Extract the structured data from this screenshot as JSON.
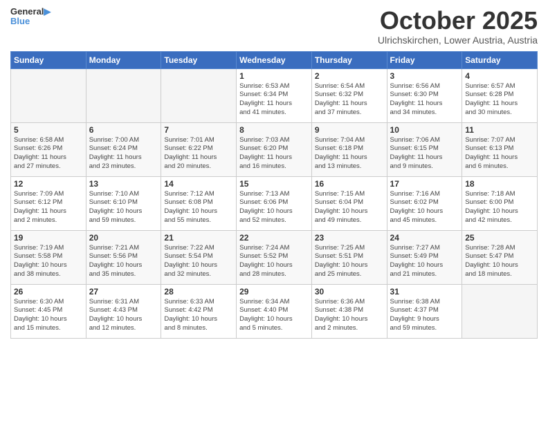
{
  "header": {
    "logo_line1": "General",
    "logo_line2": "Blue",
    "month_title": "October 2025",
    "subtitle": "Ulrichskirchen, Lower Austria, Austria"
  },
  "weekdays": [
    "Sunday",
    "Monday",
    "Tuesday",
    "Wednesday",
    "Thursday",
    "Friday",
    "Saturday"
  ],
  "weeks": [
    [
      {
        "day": "",
        "info": ""
      },
      {
        "day": "",
        "info": ""
      },
      {
        "day": "",
        "info": ""
      },
      {
        "day": "1",
        "info": "Sunrise: 6:53 AM\nSunset: 6:34 PM\nDaylight: 11 hours\nand 41 minutes."
      },
      {
        "day": "2",
        "info": "Sunrise: 6:54 AM\nSunset: 6:32 PM\nDaylight: 11 hours\nand 37 minutes."
      },
      {
        "day": "3",
        "info": "Sunrise: 6:56 AM\nSunset: 6:30 PM\nDaylight: 11 hours\nand 34 minutes."
      },
      {
        "day": "4",
        "info": "Sunrise: 6:57 AM\nSunset: 6:28 PM\nDaylight: 11 hours\nand 30 minutes."
      }
    ],
    [
      {
        "day": "5",
        "info": "Sunrise: 6:58 AM\nSunset: 6:26 PM\nDaylight: 11 hours\nand 27 minutes."
      },
      {
        "day": "6",
        "info": "Sunrise: 7:00 AM\nSunset: 6:24 PM\nDaylight: 11 hours\nand 23 minutes."
      },
      {
        "day": "7",
        "info": "Sunrise: 7:01 AM\nSunset: 6:22 PM\nDaylight: 11 hours\nand 20 minutes."
      },
      {
        "day": "8",
        "info": "Sunrise: 7:03 AM\nSunset: 6:20 PM\nDaylight: 11 hours\nand 16 minutes."
      },
      {
        "day": "9",
        "info": "Sunrise: 7:04 AM\nSunset: 6:18 PM\nDaylight: 11 hours\nand 13 minutes."
      },
      {
        "day": "10",
        "info": "Sunrise: 7:06 AM\nSunset: 6:15 PM\nDaylight: 11 hours\nand 9 minutes."
      },
      {
        "day": "11",
        "info": "Sunrise: 7:07 AM\nSunset: 6:13 PM\nDaylight: 11 hours\nand 6 minutes."
      }
    ],
    [
      {
        "day": "12",
        "info": "Sunrise: 7:09 AM\nSunset: 6:12 PM\nDaylight: 11 hours\nand 2 minutes."
      },
      {
        "day": "13",
        "info": "Sunrise: 7:10 AM\nSunset: 6:10 PM\nDaylight: 10 hours\nand 59 minutes."
      },
      {
        "day": "14",
        "info": "Sunrise: 7:12 AM\nSunset: 6:08 PM\nDaylight: 10 hours\nand 55 minutes."
      },
      {
        "day": "15",
        "info": "Sunrise: 7:13 AM\nSunset: 6:06 PM\nDaylight: 10 hours\nand 52 minutes."
      },
      {
        "day": "16",
        "info": "Sunrise: 7:15 AM\nSunset: 6:04 PM\nDaylight: 10 hours\nand 49 minutes."
      },
      {
        "day": "17",
        "info": "Sunrise: 7:16 AM\nSunset: 6:02 PM\nDaylight: 10 hours\nand 45 minutes."
      },
      {
        "day": "18",
        "info": "Sunrise: 7:18 AM\nSunset: 6:00 PM\nDaylight: 10 hours\nand 42 minutes."
      }
    ],
    [
      {
        "day": "19",
        "info": "Sunrise: 7:19 AM\nSunset: 5:58 PM\nDaylight: 10 hours\nand 38 minutes."
      },
      {
        "day": "20",
        "info": "Sunrise: 7:21 AM\nSunset: 5:56 PM\nDaylight: 10 hours\nand 35 minutes."
      },
      {
        "day": "21",
        "info": "Sunrise: 7:22 AM\nSunset: 5:54 PM\nDaylight: 10 hours\nand 32 minutes."
      },
      {
        "day": "22",
        "info": "Sunrise: 7:24 AM\nSunset: 5:52 PM\nDaylight: 10 hours\nand 28 minutes."
      },
      {
        "day": "23",
        "info": "Sunrise: 7:25 AM\nSunset: 5:51 PM\nDaylight: 10 hours\nand 25 minutes."
      },
      {
        "day": "24",
        "info": "Sunrise: 7:27 AM\nSunset: 5:49 PM\nDaylight: 10 hours\nand 21 minutes."
      },
      {
        "day": "25",
        "info": "Sunrise: 7:28 AM\nSunset: 5:47 PM\nDaylight: 10 hours\nand 18 minutes."
      }
    ],
    [
      {
        "day": "26",
        "info": "Sunrise: 6:30 AM\nSunset: 4:45 PM\nDaylight: 10 hours\nand 15 minutes."
      },
      {
        "day": "27",
        "info": "Sunrise: 6:31 AM\nSunset: 4:43 PM\nDaylight: 10 hours\nand 12 minutes."
      },
      {
        "day": "28",
        "info": "Sunrise: 6:33 AM\nSunset: 4:42 PM\nDaylight: 10 hours\nand 8 minutes."
      },
      {
        "day": "29",
        "info": "Sunrise: 6:34 AM\nSunset: 4:40 PM\nDaylight: 10 hours\nand 5 minutes."
      },
      {
        "day": "30",
        "info": "Sunrise: 6:36 AM\nSunset: 4:38 PM\nDaylight: 10 hours\nand 2 minutes."
      },
      {
        "day": "31",
        "info": "Sunrise: 6:38 AM\nSunset: 4:37 PM\nDaylight: 9 hours\nand 59 minutes."
      },
      {
        "day": "",
        "info": ""
      }
    ]
  ]
}
